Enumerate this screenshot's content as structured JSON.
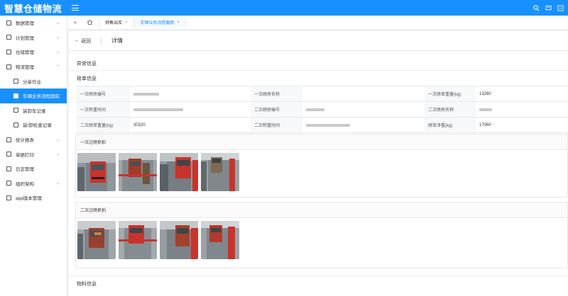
{
  "app": {
    "title": "智慧仓储物流"
  },
  "sidebar": {
    "items": [
      {
        "label": "数据管理",
        "icon": "database-icon",
        "expandable": true
      },
      {
        "label": "计划管理",
        "icon": "plan-icon",
        "expandable": true
      },
      {
        "label": "仓储管理",
        "icon": "warehouse-icon",
        "expandable": true
      },
      {
        "label": "物流管理",
        "icon": "logistics-icon",
        "expandable": true,
        "expanded": true
      },
      {
        "label": "分单作业",
        "icon": "truck-icon",
        "sub": true
      },
      {
        "label": "车辆业务流程跟踪",
        "icon": "truck-icon",
        "sub": true,
        "active": true
      },
      {
        "label": "装卸车记录",
        "icon": "record-icon",
        "sub": true
      },
      {
        "label": "装/卸检查记录",
        "icon": "checklist-icon",
        "sub": true
      },
      {
        "label": "统计报表",
        "icon": "chart-icon",
        "expandable": true
      },
      {
        "label": "单据打印",
        "icon": "print-icon",
        "expandable": true
      },
      {
        "label": "日志管理",
        "icon": "log-icon",
        "expandable": false
      },
      {
        "label": "组织架构",
        "icon": "org-icon",
        "expandable": true
      },
      {
        "label": "app版本管理",
        "icon": "app-icon",
        "expandable": false
      }
    ]
  },
  "tabs": [
    {
      "label": "销售出库",
      "active": false
    },
    {
      "label": "车辆业务流程跟踪",
      "active": true
    }
  ],
  "header": {
    "back": "返回",
    "title": "详情"
  },
  "sections": {
    "abnormal": "异常信息",
    "weighing": "磅单信息",
    "material": "物料信息"
  },
  "weighing_table": {
    "rows": [
      [
        {
          "label": "一次磅房编号",
          "value": ""
        },
        {
          "label": "一次磅房名称",
          "value": ""
        },
        {
          "label": "一次磅单重量(kg)",
          "value": "13260"
        }
      ],
      [
        {
          "label": "一次称重时间",
          "value": ""
        },
        {
          "label": "二次磅房编号",
          "value": ""
        },
        {
          "label": "二次磅房名称",
          "value": ""
        }
      ],
      [
        {
          "label": "二次磅单重量(kg)",
          "value": "30320"
        },
        {
          "label": "二次称重时间",
          "value": ""
        },
        {
          "label": "磅单净重(kg)",
          "value": "17060"
        }
      ]
    ]
  },
  "captures": {
    "first": {
      "title": "一次过磅抓拍"
    },
    "second": {
      "title": "二次过磅抓拍"
    }
  },
  "colors": {
    "primary": "#1890ff",
    "truck_red": "#c8332c"
  }
}
